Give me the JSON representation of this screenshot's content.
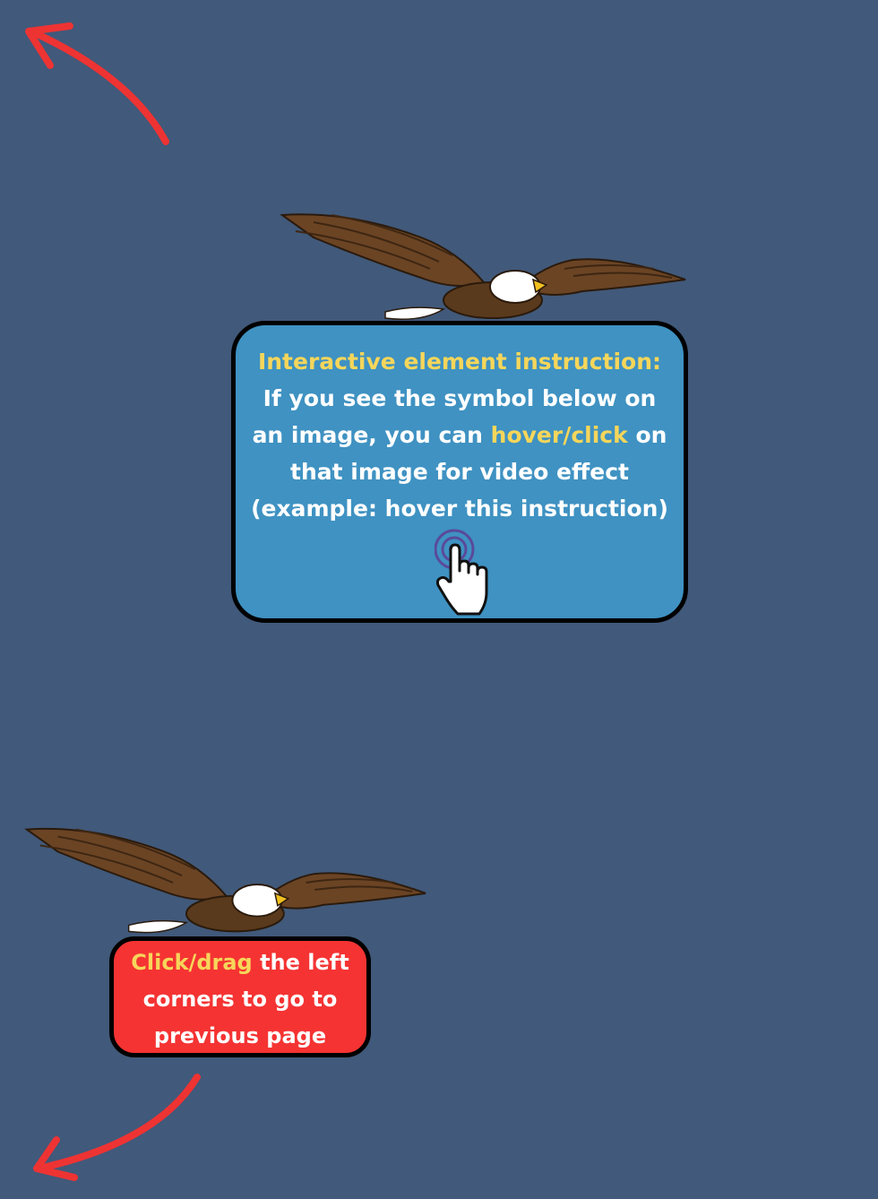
{
  "page": {
    "background_color": "#41597a"
  },
  "instruction_card": {
    "title": "Interactive element instruction:",
    "line1": "If you see the symbol below on",
    "line2_before": "an image, you can ",
    "line2_highlight": "hover/click",
    "line2_after": " on",
    "line3": "that image for video effect",
    "line4": "(example: hover this instruction)",
    "background_color": "#3f92c2",
    "highlight_color": "#f6d65a",
    "icon": "tap-hand-icon"
  },
  "nav_card": {
    "highlight": "Click/drag",
    "line1_after": " the left",
    "line2": "corners to go to",
    "line3": "previous page",
    "background_color": "#f53333"
  },
  "decorations": {
    "top_arrow_icon": "curved-arrow-up-left-icon",
    "bottom_arrow_icon": "curved-arrow-down-left-icon",
    "eagle_icon": "flying-eagle-icon",
    "arrow_color": "#ee3333"
  }
}
